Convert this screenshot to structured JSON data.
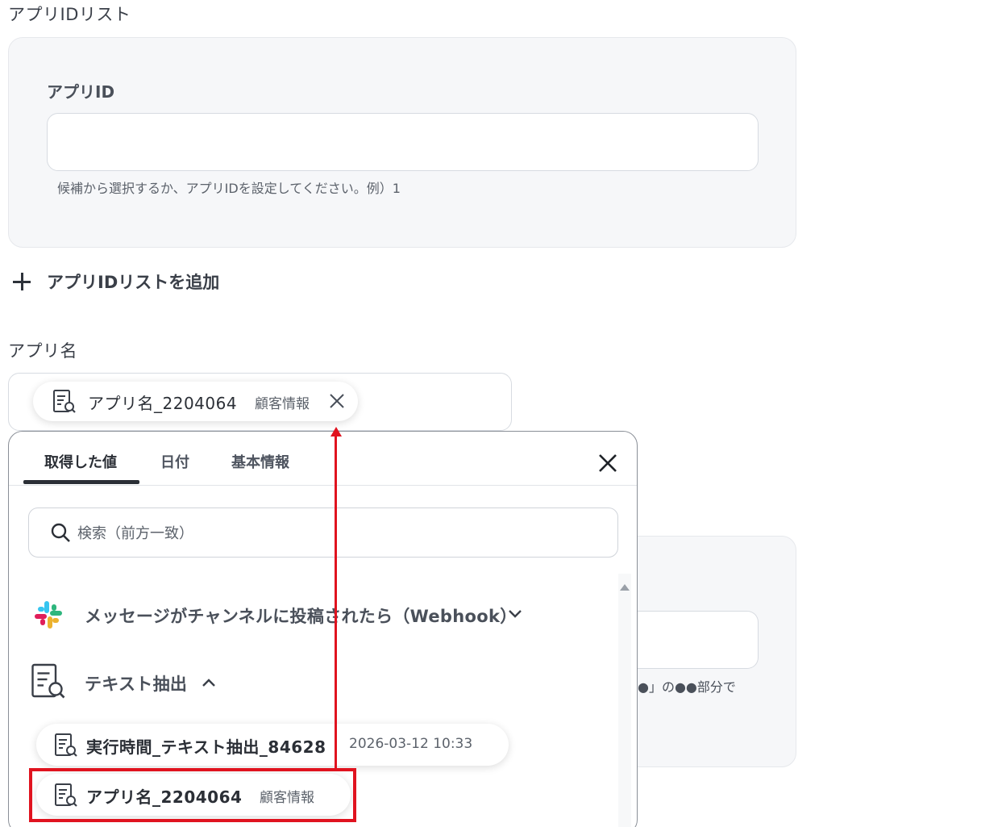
{
  "app_id_list": {
    "section_label": "アプリIDリスト",
    "field_label": "アプリID",
    "input_value": "",
    "hint": "候補から選択するか、アプリIDを設定してください。例）1",
    "add_button_label": "アプリIDリストを追加"
  },
  "app_name": {
    "section_label": "アプリ名",
    "selected_chip": {
      "icon": "text-extract-icon",
      "name": "アプリ名_2204064",
      "sub": "顧客情報"
    }
  },
  "background_panel": {
    "hint_fragment": "●」の●●部分で"
  },
  "picker": {
    "tabs": [
      {
        "label": "取得した値",
        "active": true
      },
      {
        "label": "日付",
        "active": false
      },
      {
        "label": "基本情報",
        "active": false
      }
    ],
    "search_placeholder": "検索（前方一致）",
    "groups": [
      {
        "icon": "slack-icon",
        "title": "メッセージがチャンネルに投稿されたら（Webhook）",
        "expanded": false
      },
      {
        "icon": "text-extract-icon",
        "title": "テキスト抽出",
        "expanded": true
      }
    ],
    "items": [
      {
        "icon": "text-extract-icon",
        "name": "実行時間_テキスト抽出_84628",
        "value": "2026-03-12 10:33"
      },
      {
        "icon": "text-extract-icon",
        "name": "アプリ名_2204064",
        "value": "顧客情報",
        "highlighted": true
      }
    ]
  },
  "colors": {
    "annotation_red": "#e0131f",
    "panel_bg": "#f6f7f9",
    "text_dark": "#2b2f36"
  }
}
